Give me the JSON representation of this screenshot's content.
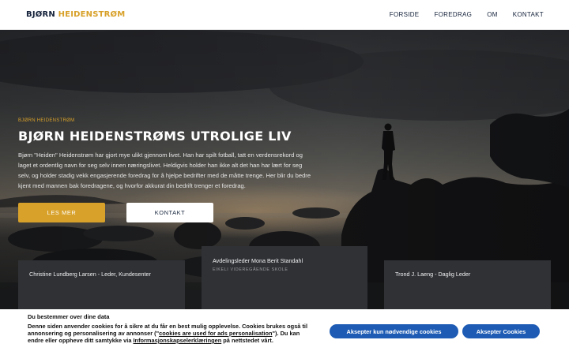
{
  "header": {
    "logo_part1": "BJØRN",
    "logo_part2": "HEIDENSTRØM",
    "nav": [
      "FORSIDE",
      "FOREDRAG",
      "OM",
      "KONTAKT"
    ]
  },
  "hero": {
    "eyebrow": "BJØRN HEIDENSTRØM",
    "title": "BJØRN HEIDENSTRØMS UTROLIGE LIV",
    "text": "Bjørn \"Heiden\" Heidenstrøm har gjort mye ulikt gjennom livet. Han har spilt fotball, tatt en verdensrekord og laget et ordentlig navn for seg selv innen næringslivet. Heldigvis holder han ikke alt det han har lært for seg selv, og holder stadig vekk engasjerende foredrag for å hjelpe bedrifter med de måtte trenge. Her blir du bedre kjent med mannen bak foredragene, og hvorfor akkurat din bedrift trenger et foredrag.",
    "btn_primary": "LES MER",
    "btn_secondary": "KONTAKT"
  },
  "testimonials": [
    {
      "name": "Christine Lundberg Larsen - Leder, Kundesenter"
    },
    {
      "name": "Avdelingsleder Mona Berit Standahl",
      "org": "EIKELI VIDEREGÅENDE SKOLE"
    },
    {
      "name": "Trond J. Laeng - Daglig Leder"
    }
  ],
  "cookie": {
    "title": "Du bestemmer over dine data",
    "text_before": "Denne siden anvender cookies for å sikre at du får en best mulig opplevelse. Cookies brukes også til annonsering og personalisering av annonser (\"",
    "link1": "cookies are used for ads personalisation",
    "text_middle": "\"). Du kan endre eller oppheve ditt samtykke via ",
    "link2": "Informasjonskapselerklæringen",
    "text_after": " på nettstedet vårt.",
    "btn_necessary": "Aksepter kun nødvendige cookies",
    "btn_accept": "Aksepter Cookies"
  },
  "colors": {
    "accent": "#d8a12a",
    "navy": "#14213a",
    "cookie_button": "#1d5bb4"
  }
}
